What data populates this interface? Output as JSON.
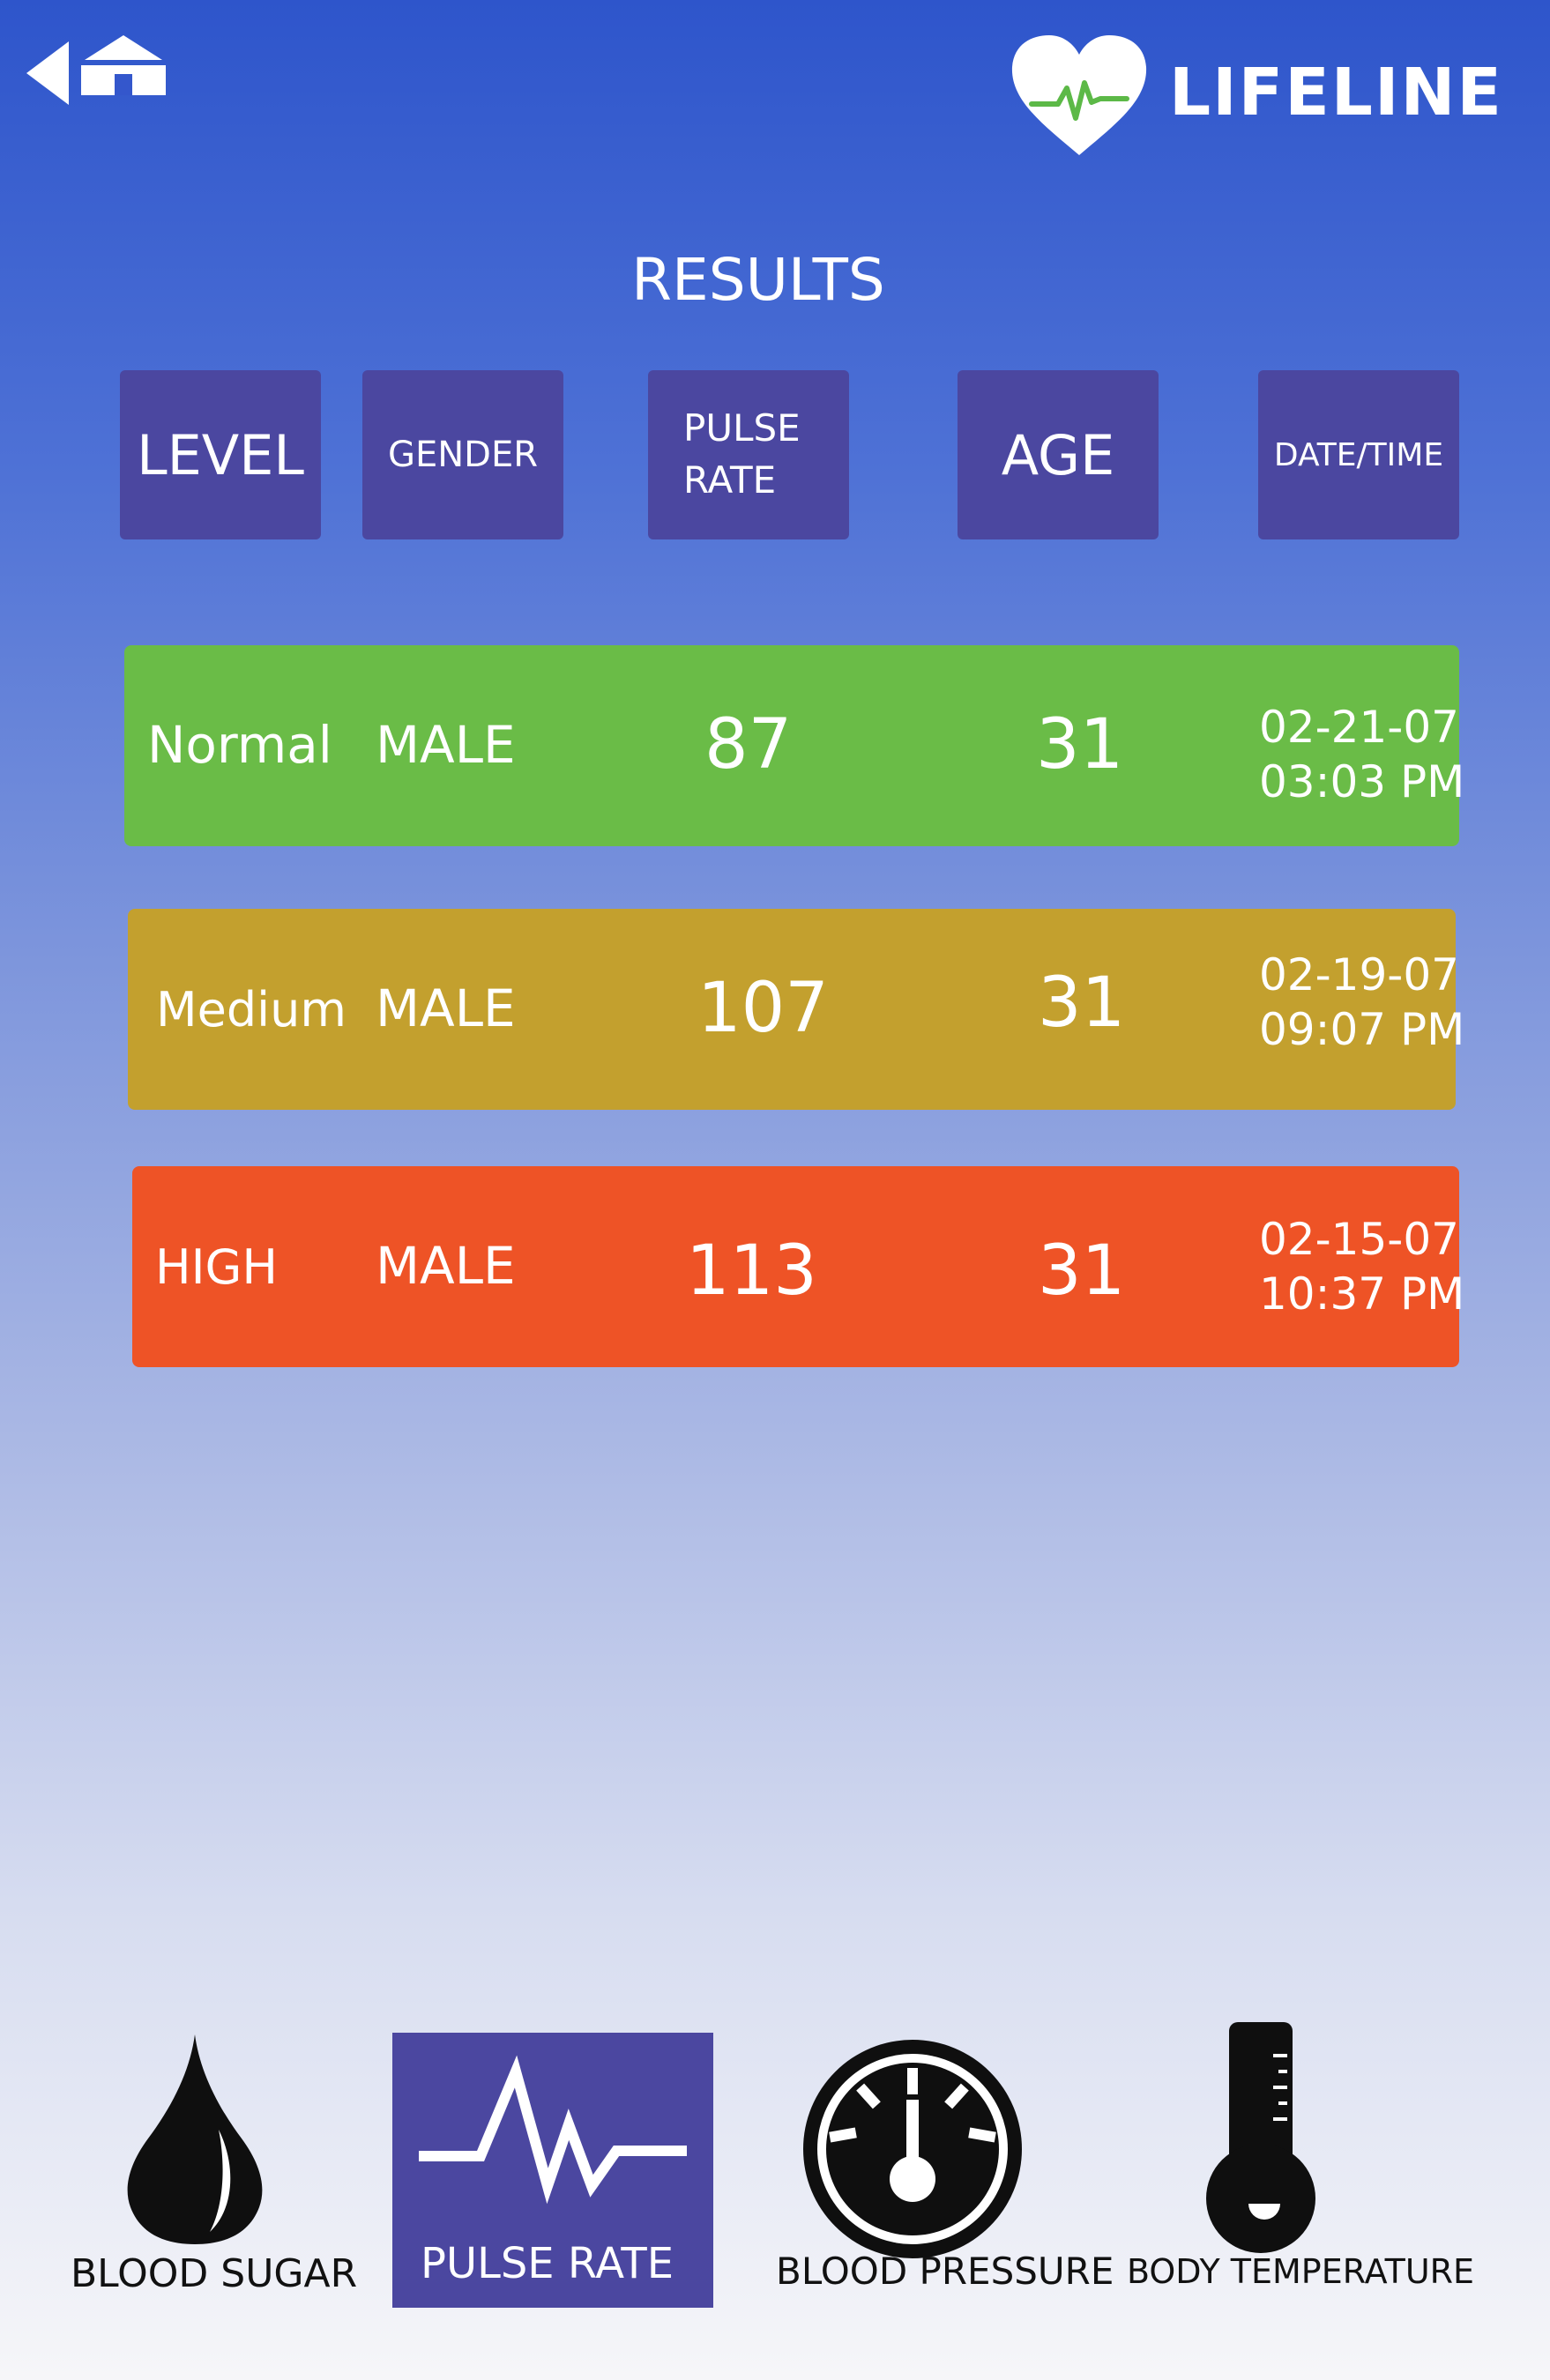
{
  "header": {
    "back_icon": "back-arrow-icon",
    "home_icon": "home-icon",
    "logo_icon": "heart-pulse-icon",
    "brand": "LIFELINE"
  },
  "page_title": "RESULTS",
  "columns": {
    "level": "LEVEL",
    "gender": "GENDER",
    "pulse_line1": "PULSE",
    "pulse_line2": "RATE",
    "age": "AGE",
    "datetime": "DATE/TIME"
  },
  "rows": [
    {
      "level": "Normal",
      "gender": "MALE",
      "pulse": "87",
      "age": "31",
      "date": "02-21-07",
      "time": "03:03 PM",
      "color": "#6abc47"
    },
    {
      "level": "Medium",
      "gender": "MALE",
      "pulse": "107",
      "age": "31",
      "date": "02-19-07",
      "time": "09:07 PM",
      "color": "#c3a02e"
    },
    {
      "level": "HIGH",
      "gender": "MALE",
      "pulse": "113",
      "age": "31",
      "date": "02-15-07",
      "time": "10:37 PM",
      "color": "#ee5326"
    }
  ],
  "nav": {
    "items": [
      {
        "label": "BLOOD SUGAR",
        "icon": "blood-drop-icon",
        "active": false
      },
      {
        "label": "PULSE RATE",
        "icon": "pulse-wave-icon",
        "active": true
      },
      {
        "label": "BLOOD PRESSURE",
        "icon": "gauge-icon",
        "active": false
      },
      {
        "label": "BODY TEMPERATURE",
        "icon": "thermometer-icon",
        "active": false
      }
    ]
  },
  "colors": {
    "accent": "#4b47a0",
    "normal": "#6abc47",
    "medium": "#c3a02e",
    "high": "#ee5326",
    "logo_pulse": "#5cb947"
  }
}
